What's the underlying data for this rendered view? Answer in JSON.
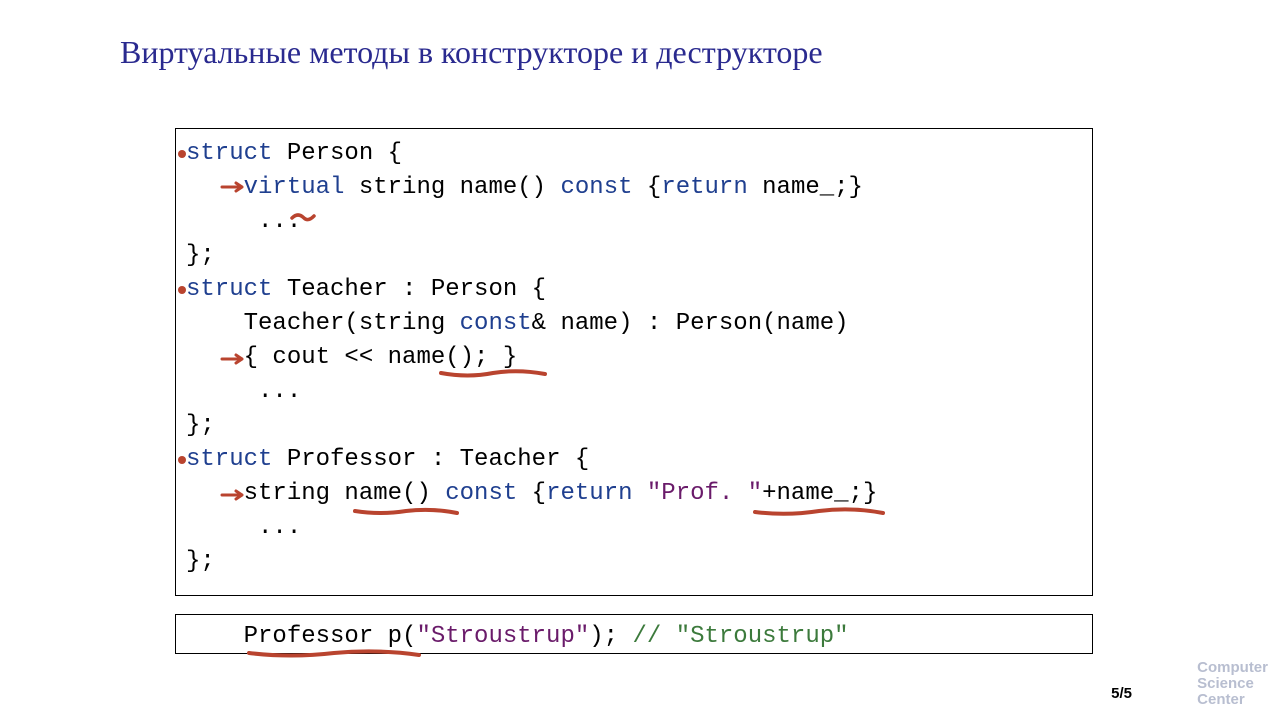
{
  "title": "Виртуальные методы в конструкторе и деструкторе",
  "code": {
    "l1": {
      "a": "struct",
      "b": " Person {"
    },
    "l2": {
      "a": "    ",
      "b": "virtual",
      "c": " string name() ",
      "d": "const",
      "e": " {",
      "f": "return",
      "g": " name_;}"
    },
    "l3": "     ...",
    "l4": "};",
    "l5": {
      "a": "struct",
      "b": " Teacher : Person {"
    },
    "l6": {
      "a": "    Teacher(string ",
      "b": "const",
      "c": "& name) : Person(name)"
    },
    "l7": "    { cout << name(); }",
    "l8": "     ...",
    "l9": "};",
    "l10": {
      "a": "struct",
      "b": " Professor : Teacher {"
    },
    "l11": {
      "a": "    string name() ",
      "b": "const",
      "c": " {",
      "d": "return",
      "e": " ",
      "f": "\"Prof. \"",
      "g": "+name_;}"
    },
    "l12": "     ...",
    "l13": "};"
  },
  "code2": {
    "a": "    Professor p(",
    "b": "\"Stroustrup\"",
    "c": "); ",
    "d": "// \"Stroustrup\""
  },
  "page": "5/5",
  "logo": {
    "l1": "Computer",
    "l2": "Science",
    "l3": "Center"
  }
}
